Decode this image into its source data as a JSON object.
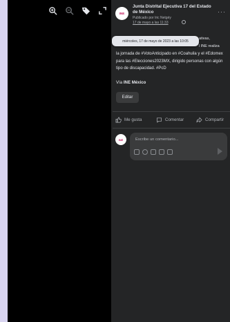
{
  "viewer": {
    "tools": [
      {
        "icon": "zoom-in-icon"
      },
      {
        "icon": "zoom-out-icon"
      },
      {
        "icon": "tag-icon"
      },
      {
        "icon": "fullscreen-icon"
      }
    ]
  },
  "post": {
    "author": "Junta Distrital Ejecutiva 17 del Estado de México",
    "published_by": "Publicado por Iric Netgéy",
    "date_short": "17 de mayo a las 11:33",
    "tooltip": "miércoles, 17 de mayo de 2023 a las 10:05",
    "more": "···",
    "text_tail": [
      "ativas,",
      "l INE realiza"
    ],
    "text": "la jornada de #VotoAnticipado en #Coahuila y el #Edomex para las #Elecciones2023MX, dirigido personas con algún tipo de discapacidad. #PcD",
    "via_prefix": "Vía",
    "via_name": "INE México",
    "edit_label": "Editar",
    "avatar_label": "INE"
  },
  "actions": {
    "like": "Me gusta",
    "comment": "Comentar",
    "share": "Compartir"
  },
  "comment": {
    "placeholder": "Escribe un comentario...",
    "avatar_label": "INE"
  }
}
